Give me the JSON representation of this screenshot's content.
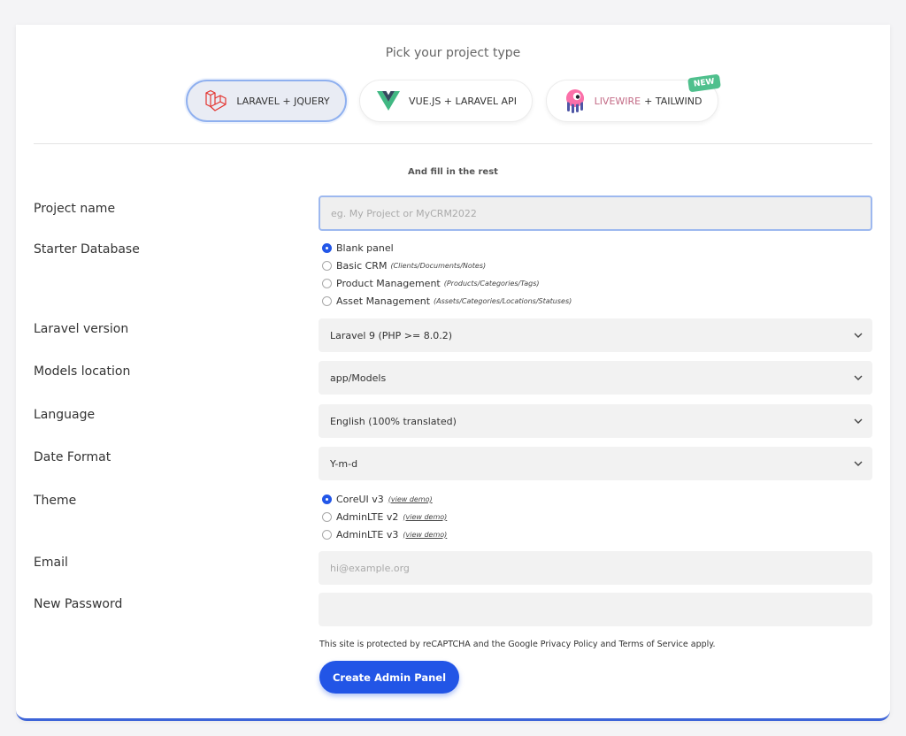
{
  "header": {
    "title": "Pick your project type"
  },
  "project_types": [
    {
      "label": "LARAVEL + JQUERY",
      "icon": "laravel-icon",
      "selected": true
    },
    {
      "label": "VUE.JS + LARAVEL API",
      "icon": "vue-icon",
      "selected": false
    },
    {
      "label_part1": "LIVEWIRE",
      "label_part2": "+ TAILWIND",
      "icon": "livewire-icon",
      "selected": false,
      "badge": "NEW"
    }
  ],
  "subtitle": "And fill in the rest",
  "form": {
    "project_name": {
      "label": "Project name",
      "placeholder": "eg. My Project or MyCRM2022"
    },
    "starter_database": {
      "label": "Starter Database",
      "options": [
        {
          "label": "Blank panel",
          "hint": "",
          "checked": true
        },
        {
          "label": "Basic CRM",
          "hint": "(Clients/Documents/Notes)",
          "checked": false
        },
        {
          "label": "Product Management",
          "hint": "(Products/Categories/Tags)",
          "checked": false
        },
        {
          "label": "Asset Management",
          "hint": "(Assets/Categories/Locations/Statuses)",
          "checked": false
        }
      ]
    },
    "laravel_version": {
      "label": "Laravel version",
      "value": "Laravel 9 (PHP >= 8.0.2)"
    },
    "models_location": {
      "label": "Models location",
      "value": "app/Models"
    },
    "language": {
      "label": "Language",
      "value": "English (100% translated)"
    },
    "date_format": {
      "label": "Date Format",
      "value": "Y-m-d"
    },
    "theme": {
      "label": "Theme",
      "options": [
        {
          "label": "CoreUI v3",
          "link": "(view demo)",
          "checked": true
        },
        {
          "label": "AdminLTE v2",
          "link": "(view demo)",
          "checked": false
        },
        {
          "label": "AdminLTE v3",
          "link": "(view demo)",
          "checked": false
        }
      ]
    },
    "email": {
      "label": "Email",
      "placeholder": "hi@example.org"
    },
    "password": {
      "label": "New Password",
      "placeholder": ""
    }
  },
  "recaptcha_notice": "This site is protected by reCAPTCHA and the Google Privacy Policy and Terms of Service apply.",
  "submit_label": "Create Admin Panel",
  "colors": {
    "accent": "#2255e6",
    "badge": "#4fc08d",
    "laravel": "#e3342f",
    "vue_green": "#41b883",
    "vue_dark": "#35495e",
    "livewire_pink": "#fb70a9"
  }
}
